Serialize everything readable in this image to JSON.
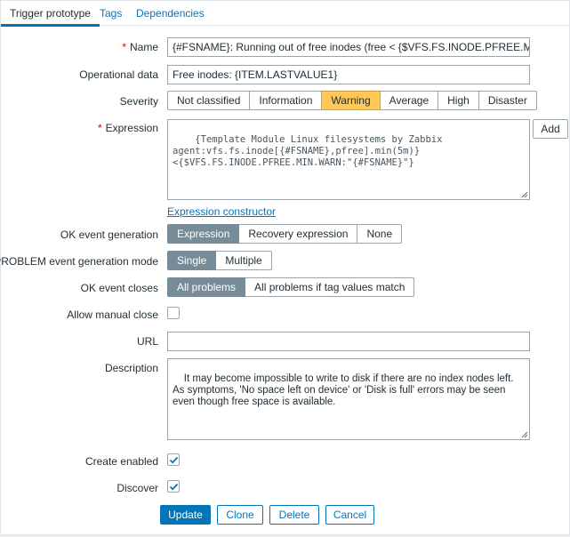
{
  "tabs": [
    {
      "label": "Trigger prototype",
      "active": true
    },
    {
      "label": "Tags",
      "active": false
    },
    {
      "label": "Dependencies",
      "active": false
    }
  ],
  "fields": {
    "name": {
      "label": "Name",
      "required": "*",
      "value": "{#FSNAME}: Running out of free inodes (free < {$VFS.FS.INODE.PFREE.MIN.WARN:\"{#FSNAME}\"}%)"
    },
    "opdata": {
      "label": "Operational data",
      "value": "Free inodes: {ITEM.LASTVALUE1}"
    },
    "severity": {
      "label": "Severity",
      "options": [
        "Not classified",
        "Information",
        "Warning",
        "Average",
        "High",
        "Disaster"
      ],
      "selected": "Warning"
    },
    "expression": {
      "label": "Expression",
      "required": "*",
      "value": "{Template Module Linux filesystems by Zabbix\nagent:vfs.fs.inode[{#FSNAME},pfree].min(5m)}\n<{$VFS.FS.INODE.PFREE.MIN.WARN:\"{#FSNAME}\"}",
      "add_label": "Add",
      "constructor_link": "Expression constructor"
    },
    "ok_event_generation": {
      "label": "OK event generation",
      "options": [
        "Expression",
        "Recovery expression",
        "None"
      ],
      "selected": "Expression"
    },
    "problem_mode": {
      "label": "PROBLEM event generation mode",
      "options": [
        "Single",
        "Multiple"
      ],
      "selected": "Single"
    },
    "ok_event_closes": {
      "label": "OK event closes",
      "options": [
        "All problems",
        "All problems if tag values match"
      ],
      "selected": "All problems"
    },
    "manual_close": {
      "label": "Allow manual close",
      "checked": false
    },
    "url": {
      "label": "URL",
      "value": ""
    },
    "description": {
      "label": "Description",
      "value": "It may become impossible to write to disk if there are no index nodes left.\nAs symptoms, 'No space left on device' or 'Disk is full' errors may be seen even though free space is available."
    },
    "create_enabled": {
      "label": "Create enabled",
      "checked": true
    },
    "discover": {
      "label": "Discover",
      "checked": true
    }
  },
  "buttons": {
    "update": "Update",
    "clone": "Clone",
    "delete": "Delete",
    "cancel": "Cancel"
  },
  "colors": {
    "accent": "#0275b8",
    "warning": "#ffc859",
    "selected_gray": "#768d99",
    "required": "#d40000"
  }
}
